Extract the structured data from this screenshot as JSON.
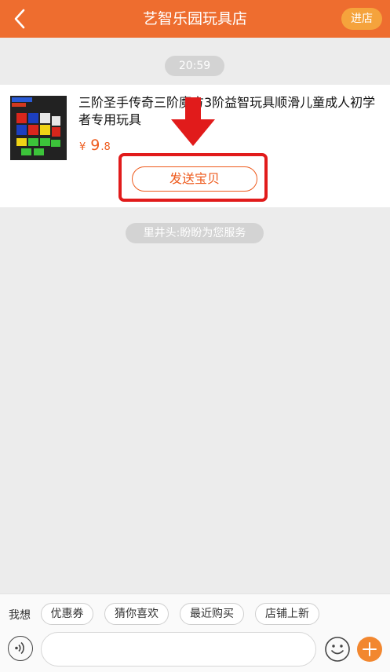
{
  "header": {
    "title": "艺智乐园玩具店",
    "enter_shop_label": "进店"
  },
  "chat": {
    "time": "20:59",
    "service_notice": "里井头:盼盼为您服务"
  },
  "product": {
    "title": "三阶圣手传奇三阶魔方3阶益智玩具顺滑儿童成人初学者专用玩具",
    "currency": "¥",
    "price_main": "9",
    "price_cents": ".8",
    "send_label": "发送宝贝"
  },
  "bottom": {
    "want_label": "我想",
    "chips": [
      "优惠券",
      "猜你喜欢",
      "最近购买",
      "店铺上新"
    ]
  },
  "colors": {
    "header": "#ee6d2f",
    "accent": "#ee5a1c",
    "highlight": "#e11b1b",
    "plus": "#f2872f"
  }
}
